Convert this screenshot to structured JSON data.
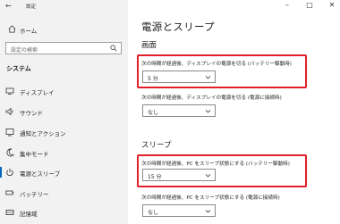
{
  "window": {
    "title": "設定"
  },
  "sidebar": {
    "home_label": "ホーム",
    "search_placeholder": "設定の検索",
    "section_title": "システム",
    "items": [
      {
        "label": "ディスプレイ",
        "icon": "display-icon"
      },
      {
        "label": "サウンド",
        "icon": "speaker-icon"
      },
      {
        "label": "通知とアクション",
        "icon": "notification-icon"
      },
      {
        "label": "集中モード",
        "icon": "moon-icon"
      },
      {
        "label": "電源とスリープ",
        "icon": "power-icon",
        "selected": true
      },
      {
        "label": "バッテリー",
        "icon": "battery-icon"
      },
      {
        "label": "記憶域",
        "icon": "storage-icon"
      }
    ]
  },
  "main": {
    "title": "電源とスリープ",
    "screen": {
      "heading": "画面",
      "battery_label": "次の時間が経過後、ディスプレイの電源を切る (バッテリー駆動時)",
      "battery_value": "5 分",
      "plugged_label": "次の時間が経過後、ディスプレイの電源を切る (電源に接続時)",
      "plugged_value": "なし"
    },
    "sleep": {
      "heading": "スリープ",
      "battery_label": "次の時間が経過後、PC をスリープ状態にする (バッテリー駆動時)",
      "battery_value": "15 分",
      "plugged_label": "次の時間が経過後、PC をスリープ状態にする (電源に接続時)",
      "plugged_value": "なし"
    }
  },
  "colors": {
    "highlight": "#e0202a",
    "accent": "#0067c0",
    "sidebar_bg": "#f2f2f2"
  }
}
